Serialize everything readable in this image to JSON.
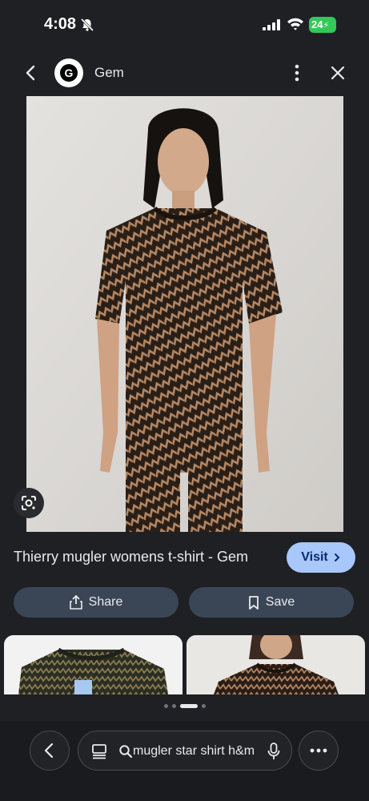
{
  "status_bar": {
    "time": "4:08",
    "battery": "24",
    "icons": [
      "bell-slash-icon",
      "signal-icon",
      "wifi-icon",
      "battery-charging-icon"
    ]
  },
  "header": {
    "site_name": "Gem",
    "logo_letter": "G",
    "icons": [
      "chevron-left-icon",
      "more-vertical-icon",
      "close-icon"
    ]
  },
  "image": {
    "subject": "woman in black sheer patterned t-shirt",
    "lens_icon": "google-lens-icon"
  },
  "result": {
    "title": "Thierry mugler womens t-shirt - Gem",
    "visit_label": "Visit"
  },
  "actions": {
    "share_label": "Share",
    "save_label": "Save"
  },
  "related": {
    "page_count": 4,
    "active_page": 3
  },
  "bottom_bar": {
    "search_query": "mugler star shirt h&m",
    "icons": [
      "chevron-left-icon",
      "tabs-icon",
      "search-icon",
      "mic-icon",
      "more-horizontal-icon"
    ]
  },
  "colors": {
    "background": "#1f2024",
    "visit_button": "#a8c7fa",
    "action_button": "#3a4656",
    "battery": "#34c759"
  }
}
